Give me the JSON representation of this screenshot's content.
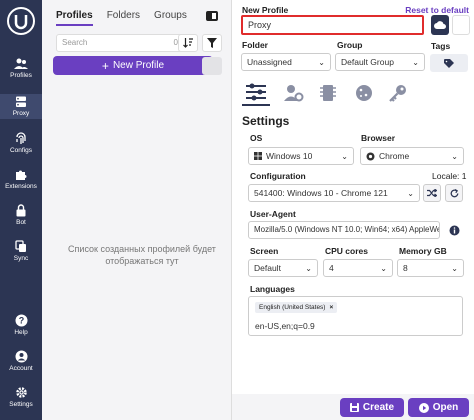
{
  "rail": {
    "items": [
      {
        "label": "Profiles"
      },
      {
        "label": "Proxy"
      },
      {
        "label": "Configs"
      },
      {
        "label": "Extensions"
      },
      {
        "label": "Bot"
      },
      {
        "label": "Sync"
      },
      {
        "label": "Help"
      },
      {
        "label": "Account"
      },
      {
        "label": "Settings"
      }
    ]
  },
  "mid": {
    "tabs": [
      {
        "label": "Profiles"
      },
      {
        "label": "Folders"
      },
      {
        "label": "Groups"
      }
    ],
    "search_placeholder": "Search",
    "search_count": "0",
    "new_profile_label": "New Profile",
    "empty_text": "Список созданных профилей будет отображаться тут"
  },
  "right": {
    "new_profile_label": "New Profile",
    "reset_label": "Reset to default",
    "name_value": "Proxy",
    "folder_label": "Folder",
    "folder_value": "Unassigned",
    "group_label": "Group",
    "group_value": "Default Group",
    "tags_label": "Tags",
    "settings_heading": "Settings",
    "os_label": "OS",
    "os_value": "Windows 10",
    "browser_label": "Browser",
    "browser_value": "Chrome",
    "config_label": "Configuration",
    "locale_label": "Locale: 1",
    "config_value": "541400: Windows 10 - Chrome 121",
    "ua_label": "User-Agent",
    "ua_value": "Mozilla/5.0 (Windows NT 10.0; Win64; x64) AppleWe",
    "screen_label": "Screen",
    "screen_value": "Default",
    "cpu_label": "CPU cores",
    "cpu_value": "4",
    "memory_label": "Memory GB",
    "memory_value": "8",
    "languages_label": "Languages",
    "language_chip": "English (United States)",
    "language_q": "en-US,en;q=0.9",
    "create_label": "Create",
    "open_label": "Open"
  },
  "colors": {
    "rail_bg": "#2c3553",
    "accent": "#6a3fc1",
    "highlight_border": "#e02c2c"
  }
}
